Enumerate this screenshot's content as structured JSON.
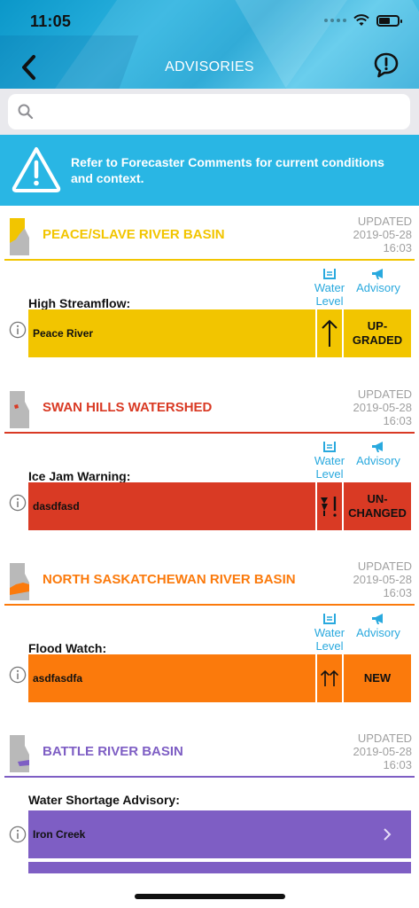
{
  "status_bar": {
    "time": "11:05"
  },
  "header": {
    "title": "ADVISORIES"
  },
  "search": {
    "placeholder": ""
  },
  "banner": {
    "text": "Refer to Forecaster Comments for current conditions and context."
  },
  "columns": {
    "water_level": "Water Level",
    "advisory": "Advisory"
  },
  "basins": [
    {
      "name": "PEACE/SLAVE RIVER BASIN",
      "color": "#f2c500",
      "updated_label": "UPDATED",
      "updated_date": "2019-05-28",
      "updated_time": "16:03",
      "advisory_type": "High Streamflow:",
      "river": "Peace River",
      "trend": "↑",
      "status": "UP-\nGRADED"
    },
    {
      "name": "SWAN HILLS WATERSHED",
      "color": "#d93a24",
      "updated_label": "UPDATED",
      "updated_date": "2019-05-28",
      "updated_time": "16:03",
      "advisory_type": "Ice Jam Warning:",
      "river": "dasdfasd",
      "trend": "ice-jam",
      "status": "UN-\nCHANGED"
    },
    {
      "name": "NORTH SASKATCHEWAN RIVER BASIN",
      "color": "#fb7a0c",
      "updated_label": "UPDATED",
      "updated_date": "2019-05-28",
      "updated_time": "16:03",
      "advisory_type": "Flood Watch:",
      "river": "asdfasdfa",
      "trend": "↑↑",
      "status": "NEW"
    },
    {
      "name": "BATTLE RIVER BASIN",
      "color": "#7e5ec4",
      "updated_label": "UPDATED",
      "updated_date": "2019-05-28",
      "updated_time": "16:03",
      "advisory_type": "Water Shortage Advisory:",
      "river": "Iron Creek",
      "trend": "",
      "status": ""
    }
  ],
  "icons": {
    "back": "chevron-left-icon",
    "comment": "comment-alert-icon",
    "search": "search-icon",
    "banner": "warning-triangle-icon",
    "info": "info-icon",
    "water": "water-level-icon",
    "advisory": "megaphone-icon",
    "row_chevron": "chevron-right-icon"
  }
}
